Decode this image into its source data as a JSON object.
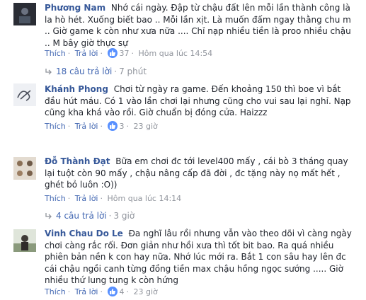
{
  "comments": [
    {
      "author": "Phương Nam",
      "text": "Nhớ cái ngày. Đập từ chậu đất lên mỗi lần thành công là la hò hét. Xuống biết bao .. Mỗi lần xịt. Là muốn đấm ngay thằng chu m .. Giờ game k còn như xưa nữa .... Chỉ nạp nhiều tiền là proo nhiều chậu .. M bây giờ thực sự",
      "like": "Thích",
      "reply": "Trả lời",
      "reactions": "37",
      "time": "Hôm qua lúc 14:54",
      "replies": "18 câu trả lời",
      "replies_time": "7 phút"
    },
    {
      "author": "Khánh Phong",
      "text": "Chơi từ ngày ra game. Đến khoảng 150 thì boe vì bắt đầu hút máu. Có 1 vào lần chơi lại nhưng cũng cho vui sau lại nghỉ. Nạp cũng kha khá vào rồi. Giờ chuẩn bị đóng cửa. Haizzz",
      "like": "Thích",
      "reply": "Trả lời",
      "reactions": "3",
      "time": "23 giờ"
    },
    {
      "author": "Đỗ Thành Đạt",
      "text": "Bữa em chơi đc tới level400 mấy , cái bò 3 tháng quay lại tuột còn 90 mấy , chậu nâng cấp đã đời , đc tặng này nọ mất hết , ghét bỏ luôn :O))",
      "like": "Thích",
      "reply": "Trả lời",
      "reactions": "Hôm qua lúc 14:14",
      "time": "",
      "replies": "4 câu trả lời",
      "replies_time": "3 giờ"
    },
    {
      "author": "Vinh Chau Do Le",
      "text": "Đa nghĩ lâu rồi nhưng vẫn vào theo dõi vì càng ngày chơi càng rắc rối. Đơn giản như hồi xưa thì tốt bit bao. Ra quá nhiều phiên bản nền k con hay nữa. Nhớ lúc mới ra. Bắt 1 con sâu hay lên đc cái chậu ngồi canh từng đồng tiền max chậu hồng ngọc sướng ..... Giờ nhiều thứ lung tung k còn hứng",
      "like": "Thích",
      "reply": "Trả lời",
      "reactions": "4",
      "time": "23 giờ"
    }
  ],
  "colors": {
    "link": "#4267b2",
    "author": "#365899",
    "meta": "#90949c",
    "like_badge": "#5890ff"
  }
}
